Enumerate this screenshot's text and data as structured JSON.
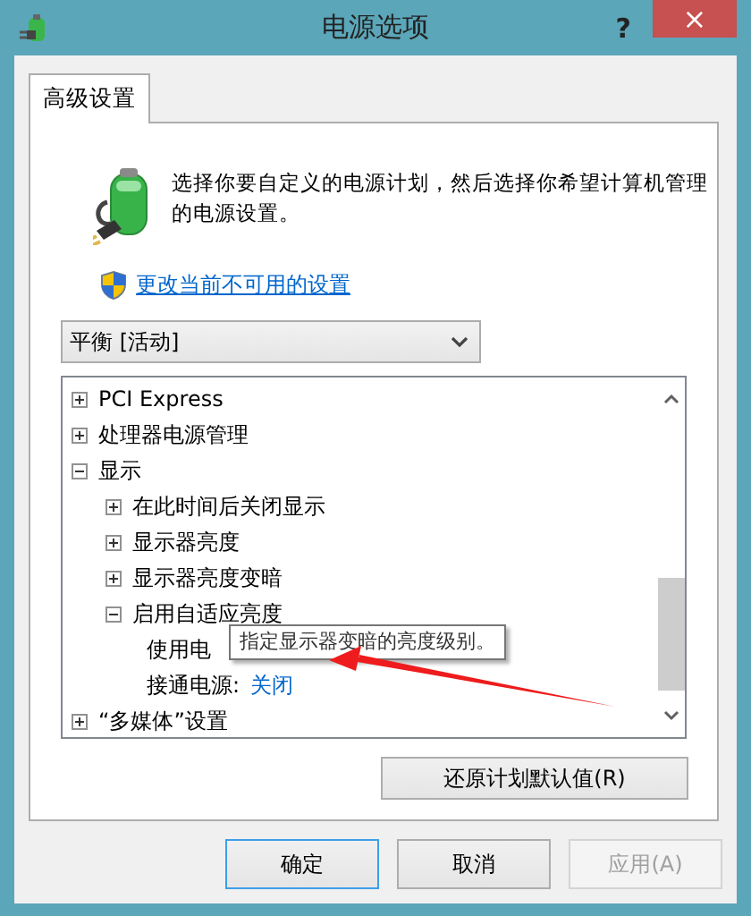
{
  "window": {
    "title": "电源选项",
    "help": "?",
    "close": "×"
  },
  "tabs": [
    {
      "label": "高级设置",
      "selected": true
    }
  ],
  "description": "选择你要自定义的电源计划，然后选择你希望计算机管理的电源设置。",
  "change_link": "更改当前不可用的设置",
  "plan_dropdown": {
    "value": "平衡 [活动]"
  },
  "tree": [
    {
      "label": "PCI Express",
      "expanded": false
    },
    {
      "label": "处理器电源管理",
      "expanded": false
    },
    {
      "label": "显示",
      "expanded": true,
      "children": [
        {
          "label": "在此时间后关闭显示",
          "expanded": false
        },
        {
          "label": "显示器亮度",
          "expanded": false
        },
        {
          "label": "显示器亮度变暗",
          "expanded": false
        },
        {
          "label": "启用自适应亮度",
          "expanded": true,
          "children": [
            {
              "label": "使用电",
              "kind": "setting"
            },
            {
              "label": "接通电源:",
              "value": "关闭",
              "kind": "setting"
            }
          ]
        }
      ]
    },
    {
      "label": "“多媒体”设置",
      "expanded": false
    }
  ],
  "tooltip": "指定显示器变暗的亮度级别。",
  "restore_button": "还原计划默认值(R)",
  "buttons": [
    {
      "label": "确定",
      "default": true,
      "disabled": false
    },
    {
      "label": "取消",
      "default": false,
      "disabled": false
    },
    {
      "label": "应用(A)",
      "default": false,
      "disabled": true
    }
  ]
}
